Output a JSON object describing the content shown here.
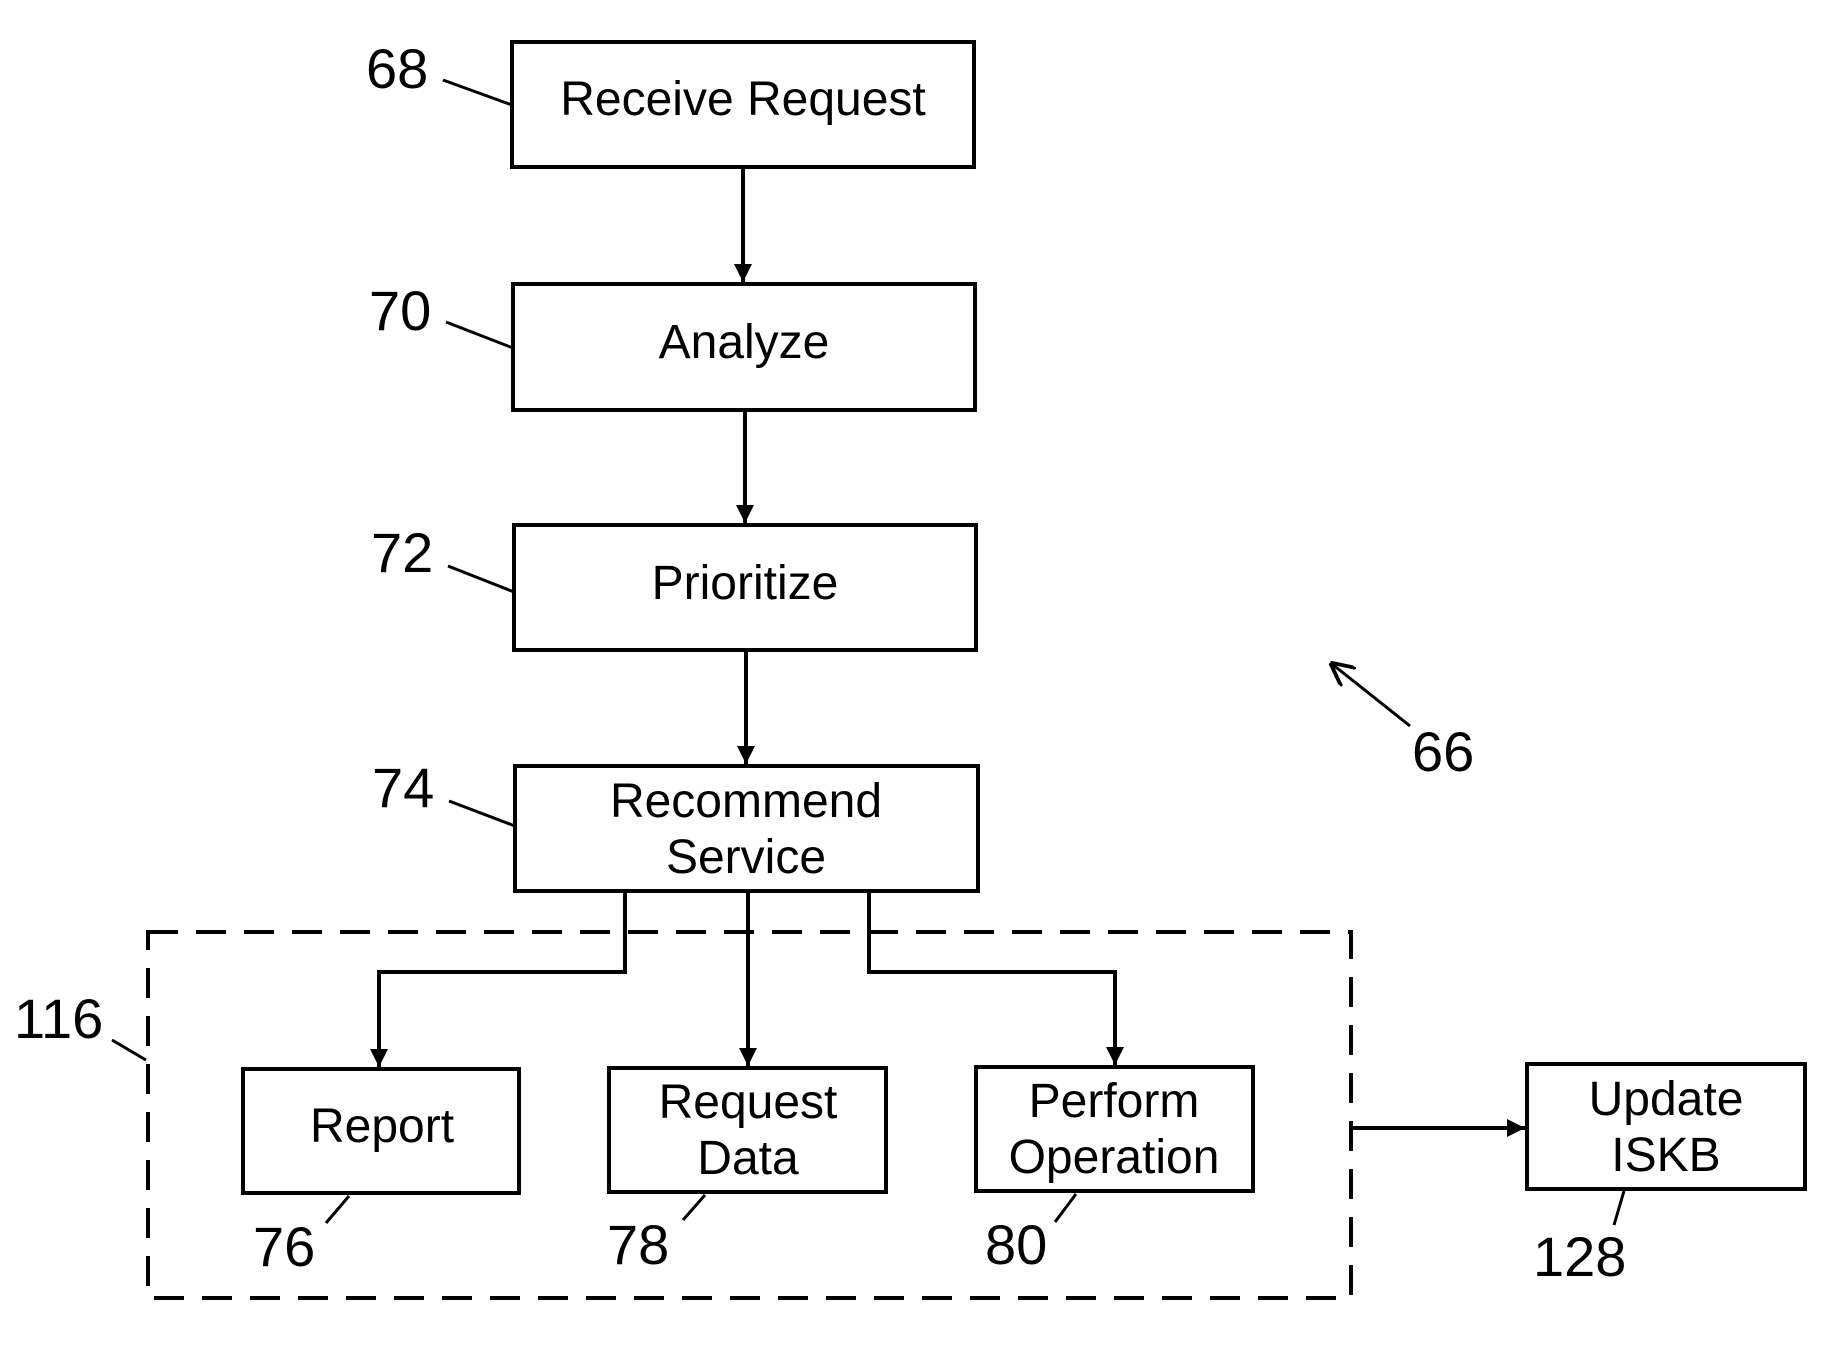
{
  "diagram": {
    "figure_ref": "66",
    "colors": {
      "ink": "#000000",
      "background": "#ffffff"
    },
    "steps": [
      {
        "id": "receive",
        "ref": "68",
        "lines": [
          "Receive Request"
        ]
      },
      {
        "id": "analyze",
        "ref": "70",
        "lines": [
          "Analyze"
        ]
      },
      {
        "id": "prioritize",
        "ref": "72",
        "lines": [
          "Prioritize"
        ]
      },
      {
        "id": "recommend",
        "ref": "74",
        "lines": [
          "Recommend",
          "Service"
        ]
      }
    ],
    "group": {
      "ref": "116",
      "style": "dashed",
      "options": [
        {
          "id": "report",
          "ref": "76",
          "lines": [
            "Report"
          ]
        },
        {
          "id": "request-data",
          "ref": "78",
          "lines": [
            "Request",
            "Data"
          ]
        },
        {
          "id": "perform-operation",
          "ref": "80",
          "lines": [
            "Perform",
            "Operation"
          ]
        }
      ]
    },
    "final": {
      "id": "update-iskb",
      "ref": "128",
      "lines": [
        "Update",
        "ISKB"
      ]
    },
    "edges": [
      [
        "receive",
        "analyze"
      ],
      [
        "analyze",
        "prioritize"
      ],
      [
        "prioritize",
        "recommend"
      ],
      [
        "recommend",
        "report"
      ],
      [
        "recommend",
        "request-data"
      ],
      [
        "recommend",
        "perform-operation"
      ],
      [
        "group-116",
        "update-iskb"
      ]
    ]
  }
}
